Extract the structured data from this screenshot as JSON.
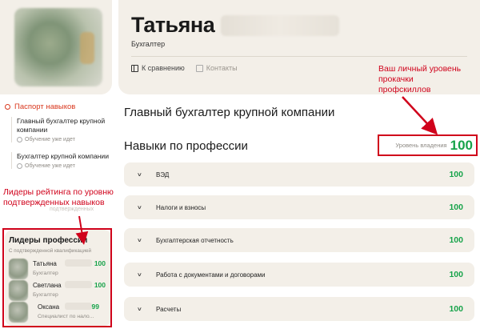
{
  "profile": {
    "first_name": "Татьяна",
    "position": "Бухгалтер",
    "actions": {
      "compare": "К сравнению",
      "contacts": "Контакты"
    }
  },
  "annotations": {
    "top": "Ваш личный уровень прокачки профскиллов",
    "middle": "Лидеры рейтинга по уровню подтвержденных навыков"
  },
  "sidebar": {
    "header": "Паспорт навыков",
    "items": [
      {
        "title": "Главный бухгалтер крупной компании",
        "status": "Обучение уже идет"
      },
      {
        "title": "Бухгалтер крупной компании",
        "status": "Обучение уже идет"
      }
    ],
    "ghost": "подтвержденных"
  },
  "leaders": {
    "title": "Лидеры профессии",
    "subtitle": "С подтвержденной квалификацией",
    "items": [
      {
        "name": "Татьяна",
        "role": "Бухгалтер",
        "score": "100"
      },
      {
        "name": "Светлана",
        "role": "Бухгалтер",
        "score": "100"
      },
      {
        "name": "Оксана",
        "role": "Специалист по нало...",
        "score": "99"
      }
    ]
  },
  "main": {
    "title": "Главный бухгалтер крупной компании",
    "skills_title": "Навыки по профессии",
    "level_label": "Уровень владения",
    "level_value": "100",
    "skills": [
      {
        "label": "ВЭД",
        "value": "100"
      },
      {
        "label": "Налоги и взносы",
        "value": "100"
      },
      {
        "label": "Бухгалтерская отчетность",
        "value": "100"
      },
      {
        "label": "Работа с документами и договорами",
        "value": "100"
      },
      {
        "label": "Расчеты",
        "value": "100"
      }
    ]
  },
  "colors": {
    "accent_green": "#17a34a",
    "annotation_red": "#d0021b",
    "card_bg": "#f3efe8",
    "sidebar_active": "#d9381e"
  }
}
